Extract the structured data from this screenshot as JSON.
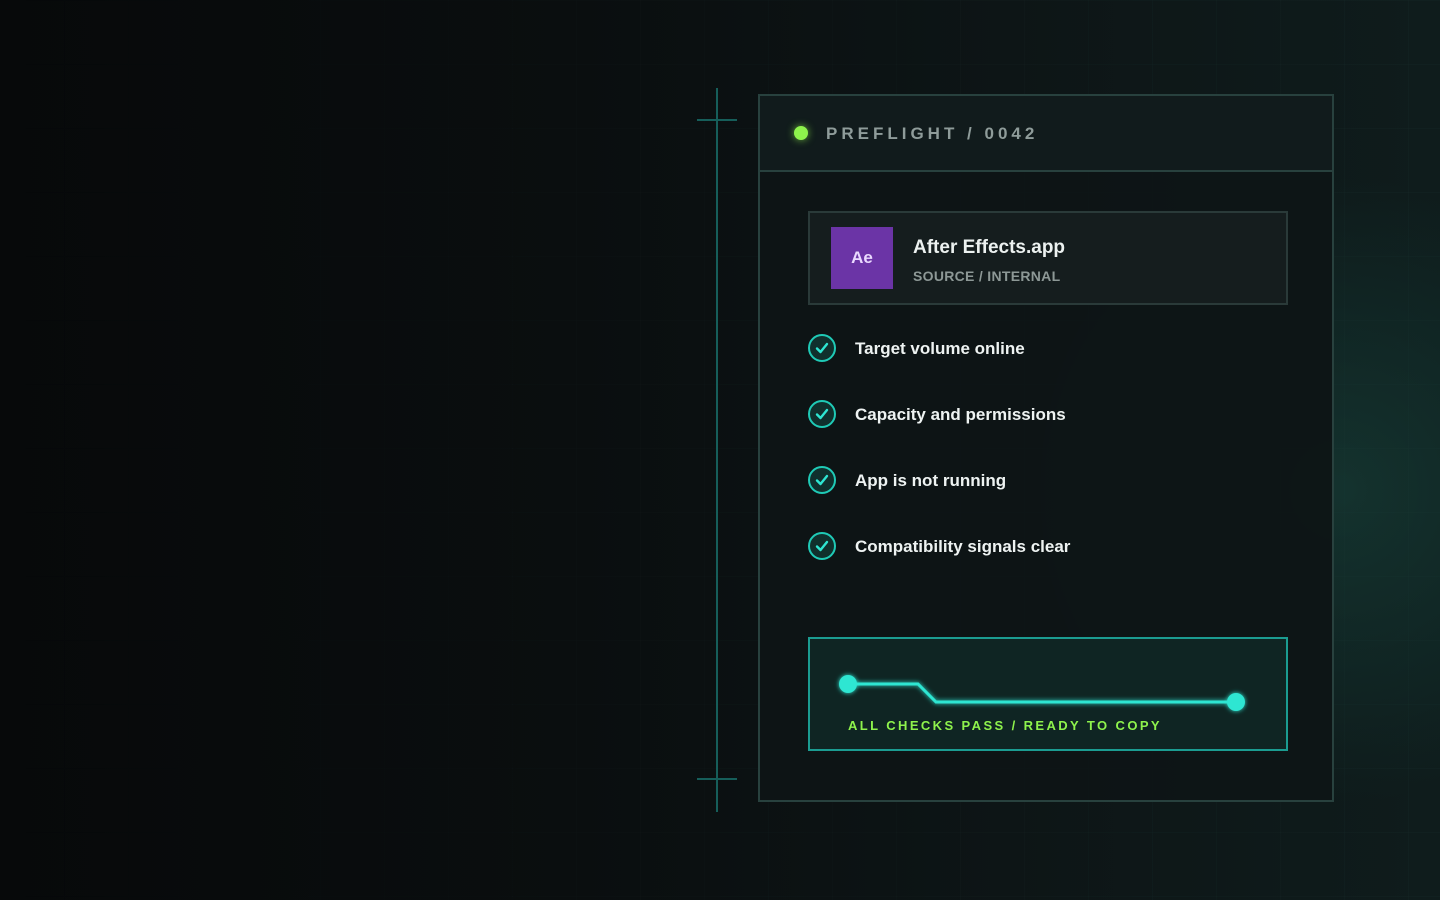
{
  "panel": {
    "title": "PREFLIGHT / 0042",
    "status_color": "#8ef34c"
  },
  "app": {
    "icon_label": "Ae",
    "icon_color": "#6b34a6",
    "name": "After Effects.app",
    "subtitle": "SOURCE / INTERNAL"
  },
  "checks": [
    {
      "label": "Target volume online",
      "status": "pass",
      "icon": "check-icon"
    },
    {
      "label": "Capacity and permissions",
      "status": "pass",
      "icon": "check-icon"
    },
    {
      "label": "App is not running",
      "status": "pass",
      "icon": "check-icon"
    },
    {
      "label": "Compatibility signals clear",
      "status": "pass",
      "icon": "check-icon"
    }
  ],
  "ready": {
    "message": "ALL CHECKS PASS / READY TO COPY",
    "accent_color": "#2ee6d2"
  }
}
